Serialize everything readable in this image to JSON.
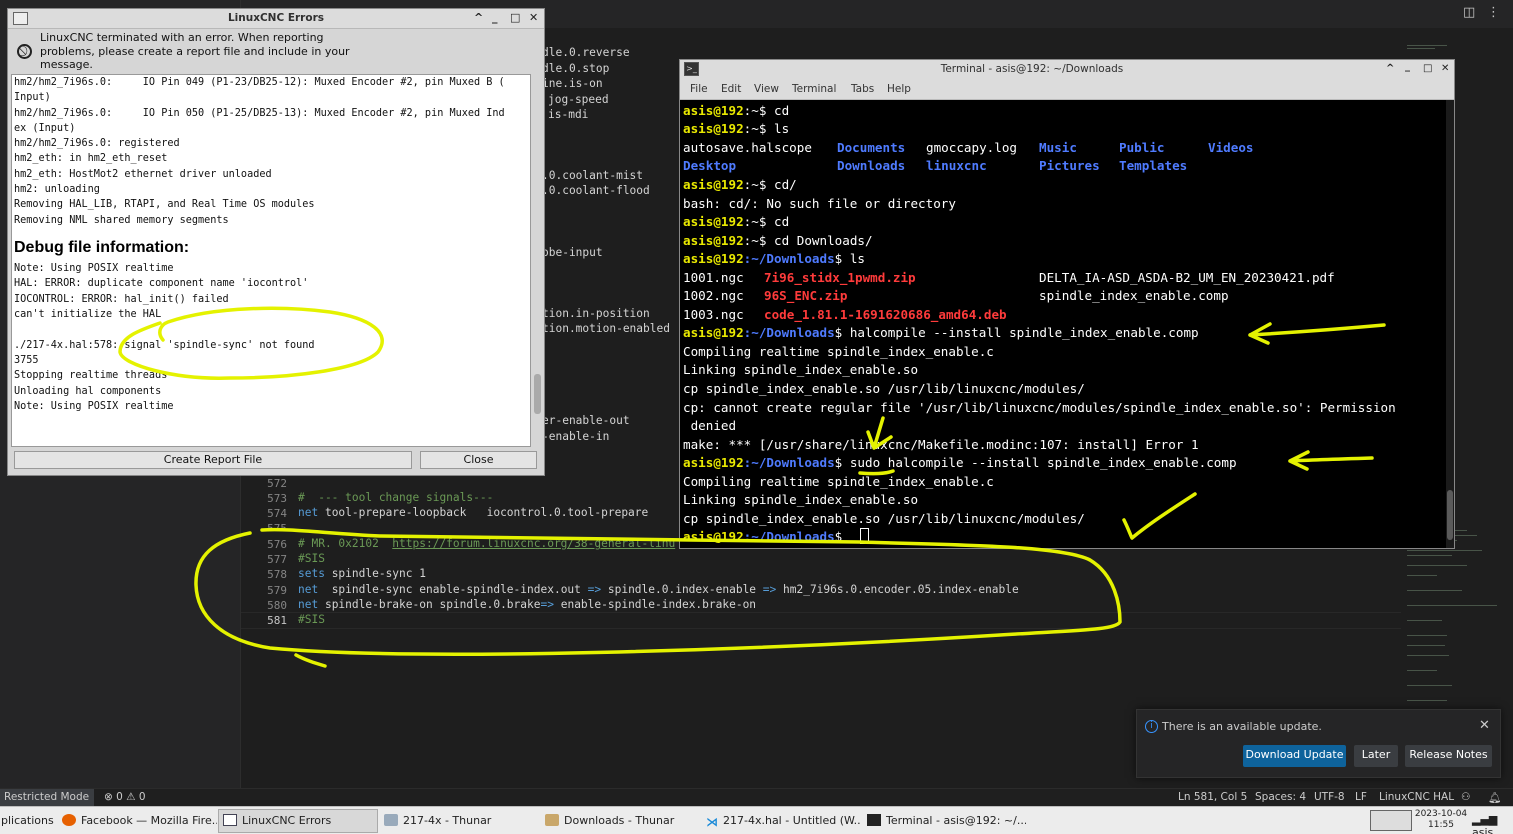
{
  "vscode": {
    "line_numbers": [
      "572",
      "573",
      "574",
      "575",
      "576",
      "577",
      "578",
      "579",
      "580",
      "581"
    ],
    "background_fragments": {
      "f1": "dle.0.reverse",
      "f2": "dle.0.stop",
      "f3": "ine.is-on",
      "f4": "jog-speed",
      "f5": "is-mdi",
      "f6": ".0.coolant-mist",
      "f7": ".0.coolant-flood",
      "f8": "obe-input",
      "f9": "tion.in-position",
      "f10": "tion.motion-enabled",
      "f11": "er-enable-out",
      "f12": "-enable-in"
    },
    "lines": {
      "l573": "#  --- tool change signals---",
      "l574_kw": "net",
      "l574_rest": " tool-prepare-loopback   iocontrol.0.tool-prepare",
      "l576_cm": "# MR. 0x2102  ",
      "l576_link": "https://forum.linuxcnc.org/38-general-linu",
      "l577": "#SIS",
      "l578_kw": "sets",
      "l578_rest": " spindle-sync 1",
      "l579_kw": "net",
      "l579_a": "  spindle-sync enable-spindle-index.out ",
      "l579_op1": "=>",
      "l579_b": " spindle.0.index-enable ",
      "l579_op2": "=>",
      "l579_c": " hm2_7i96s.0.encoder.05.index-enable",
      "l580_kw": "net",
      "l580_a": " spindle-brake-on spindle.0.brake",
      "l580_op": "=>",
      "l580_b": " enable-spindle-index.brake-on",
      "l581": "#SIS"
    },
    "status_bar": {
      "restricted": "Restricted Mode",
      "problems": "⊗ 0 ⚠ 0",
      "position": "Ln 581, Col 5",
      "spaces": "Spaces: 4",
      "encoding": "UTF-8",
      "eol": "LF",
      "language": "LinuxCNC HAL"
    },
    "notification": {
      "message": "There is an available update.",
      "download": "Download Update",
      "later": "Later",
      "release_notes": "Release Notes"
    }
  },
  "lcnc_dialog": {
    "title": "LinuxCNC Errors",
    "message": "LinuxCNC terminated with an error.  When reporting problems, please create a report file and include in your message.",
    "log_lines": [
      "hm2/hm2_7i96s.0:     IO Pin 049 (P1-23/DB25-12): Muxed Encoder #2, pin Muxed B (",
      "Input)",
      "hm2/hm2_7i96s.0:     IO Pin 050 (P1-25/DB25-13): Muxed Encoder #2, pin Muxed Ind",
      "ex (Input)",
      "hm2/hm2_7i96s.0: registered",
      "hm2_eth: in hm2_eth_reset",
      "hm2_eth: HostMot2 ethernet driver unloaded",
      "hm2: unloading",
      "Removing HAL_LIB, RTAPI, and Real Time OS modules",
      "Removing NML shared memory segments"
    ],
    "debug_heading": "Debug file information:",
    "debug_lines": [
      "Note: Using POSIX realtime",
      "HAL: ERROR: duplicate component name 'iocontrol'",
      "IOCONTROL: ERROR: hal_init() failed",
      "can't initialize the HAL",
      "",
      "./217-4x.hal:578: signal 'spindle-sync' not found",
      "3755",
      "Stopping realtime threads",
      "Unloading hal components",
      "Note: Using POSIX realtime"
    ],
    "create_report": "Create Report File",
    "close": "Close"
  },
  "terminal": {
    "title": "Terminal - asis@192: ~/Downloads",
    "menu": [
      "File",
      "Edit",
      "View",
      "Terminal",
      "Tabs",
      "Help"
    ],
    "prompt_user": "asis@192",
    "home_path": ":~",
    "dl_path": ":~/Downloads",
    "dollar": "$",
    "cmd_cd": " cd",
    "cmd_ls": " ls",
    "ls_home": {
      "c1a": "autosave.halscope",
      "c2a": "Documents",
      "c3a": "gmoccapy.log",
      "c4a": "Music",
      "c5a": "Public",
      "c6a": "Videos",
      "c1b": "Desktop",
      "c2b": "Downloads",
      "c3b": "linuxcnc",
      "c4b": "Pictures",
      "c5b": "Templates"
    },
    "cmd_cd_slash": " cd/",
    "err_cd_slash": "bash: cd/: No such file or directory",
    "cmd_cd_dl": " cd Downloads/",
    "ls_dl": {
      "a1": "1001.ngc",
      "a2": "7i96_stidx_1pwmd.zip",
      "a3": "DELTA_IA-ASD_ASDA-B2_UM_EN_20230421.pdf",
      "b1": "1002.ngc",
      "b2": "96S_ENC.zip",
      "b3": "spindle_index_enable.comp",
      "c1": "1003.ngc",
      "c2": "code_1.81.1-1691620686_amd64.deb"
    },
    "cmd_halcompile": " halcompile --install spindle_index_enable.comp",
    "out1": "Compiling realtime spindle_index_enable.c",
    "out2": "Linking spindle_index_enable.so",
    "out3": "cp spindle_index_enable.so /usr/lib/linuxcnc/modules/",
    "out4": "cp: cannot create regular file '/usr/lib/linuxcnc/modules/spindle_index_enable.so': Permission",
    "out5": " denied",
    "out6": "make: *** [/usr/share/linuxcnc/Makefile.modinc:107: install] Error 1",
    "cmd_sudo": " sudo halcompile --install spindle_index_enable.comp",
    "out7": "Compiling realtime spindle_index_enable.c",
    "out8": "Linking spindle_index_enable.so",
    "out9": "cp spindle_index_enable.so /usr/lib/linuxcnc/modules/"
  },
  "taskbar": {
    "items": [
      "plications",
      "Facebook — Mozilla Fire...",
      "LinuxCNC Errors",
      "217-4x - Thunar",
      "Downloads - Thunar",
      "217-4x.hal - Untitled (W...",
      "Terminal - asis@192: ~/..."
    ],
    "date": "2023-10-04",
    "time": "11:55",
    "user": "asis"
  },
  "colors": {
    "prompt": "#e9e900",
    "path": "#4f7bff",
    "archive": "#ff3b3b",
    "annotation": "#e4f200",
    "vscode_accent": "#0e639c"
  }
}
